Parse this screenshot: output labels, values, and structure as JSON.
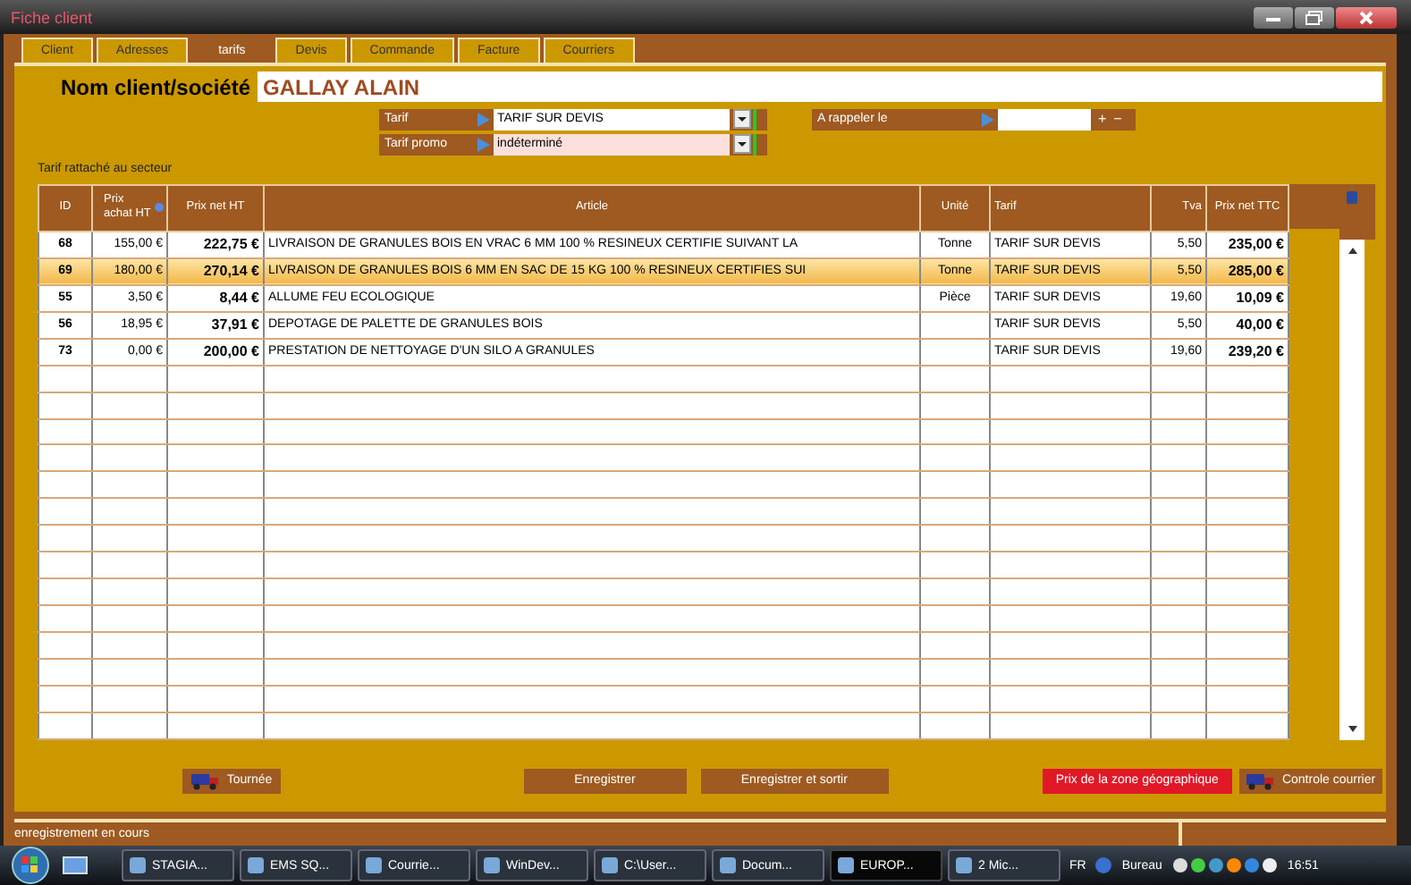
{
  "window": {
    "title": "Fiche client"
  },
  "tabs": [
    {
      "label": "Client",
      "selected": false
    },
    {
      "label": "Adresses",
      "selected": false
    },
    {
      "label": "tarifs",
      "selected": true
    },
    {
      "label": "Devis",
      "selected": false
    },
    {
      "label": "Commande",
      "selected": false
    },
    {
      "label": "Facture",
      "selected": false
    },
    {
      "label": "Courriers",
      "selected": false
    }
  ],
  "client": {
    "label": "Nom client/société",
    "value": "GALLAY ALAIN"
  },
  "tarif": {
    "label": "Tarif",
    "value": "TARIF SUR DEVIS"
  },
  "tarif_promo": {
    "label": "Tarif promo",
    "value": "indéterminé"
  },
  "rappel": {
    "label": "A rappeler le",
    "plus": "+",
    "minus": "−"
  },
  "section_label": "Tarif rattaché au secteur",
  "table": {
    "columns": [
      "ID",
      "Prix achat HT",
      "Prix net HT",
      "Article",
      "Unité",
      "Tarif",
      "Tva",
      "Prix net TTC"
    ],
    "rows": [
      {
        "id": "68",
        "achat": "155,00 €",
        "net_ht": "222,75 €",
        "article": "LIVRAISON DE GRANULES BOIS EN VRAC 6 MM 100 % RESINEUX CERTIFIE SUIVANT LA",
        "unite": "Tonne",
        "tarif": "TARIF SUR DEVIS",
        "tva": "5,50",
        "ttc": "235,00 €",
        "selected": false
      },
      {
        "id": "69",
        "achat": "180,00 €",
        "net_ht": "270,14 €",
        "article": "LIVRAISON DE GRANULES BOIS 6 MM EN SAC DE 15 KG 100 % RESINEUX CERTIFIES SUI",
        "unite": "Tonne",
        "tarif": "TARIF SUR DEVIS",
        "tva": "5,50",
        "ttc": "285,00 €",
        "selected": true
      },
      {
        "id": "55",
        "achat": "3,50 €",
        "net_ht": "8,44 €",
        "article": "ALLUME FEU ECOLOGIQUE",
        "unite": "Pièce",
        "tarif": "TARIF SUR DEVIS",
        "tva": "19,60",
        "ttc": "10,09 €",
        "selected": false
      },
      {
        "id": "56",
        "achat": "18,95 €",
        "net_ht": "37,91 €",
        "article": "DEPOTAGE DE PALETTE DE GRANULES BOIS",
        "tarif": "TARIF SUR DEVIS",
        "tva": "5,50",
        "ttc": "40,00 €",
        "selected": false
      },
      {
        "id": "73",
        "achat": "0,00 €",
        "net_ht": "200,00 €",
        "article": "PRESTATION DE NETTOYAGE D'UN SILO A GRANULES",
        "tarif": "TARIF SUR DEVIS",
        "tva": "19,60",
        "ttc": "239,20 €",
        "selected": false
      }
    ]
  },
  "buttons": [
    {
      "label": "Tournée",
      "kind": "icon"
    },
    {
      "label": "Enregistrer",
      "kind": "plain"
    },
    {
      "label": "Enregistrer et sortir",
      "kind": "plain"
    },
    {
      "label": "Prix de la zone géographique",
      "kind": "alert"
    },
    {
      "label": "Controle courrier",
      "kind": "icon"
    }
  ],
  "status_bar": "enregistrement en cours",
  "taskbar": {
    "items": [
      {
        "label": "STAGIA...",
        "selected": false
      },
      {
        "label": "EMS SQ...",
        "selected": false
      },
      {
        "label": "Courrie...",
        "selected": false
      },
      {
        "label": "WinDev...",
        "selected": false
      },
      {
        "label": "C:\\User...",
        "selected": false
      },
      {
        "label": "Docum...",
        "selected": false
      },
      {
        "label": "EUROP...",
        "selected": true
      },
      {
        "label": "2 Mic...",
        "selected": false
      }
    ],
    "language": "FR",
    "toolbar": "Bureau",
    "clock": "16:51"
  }
}
